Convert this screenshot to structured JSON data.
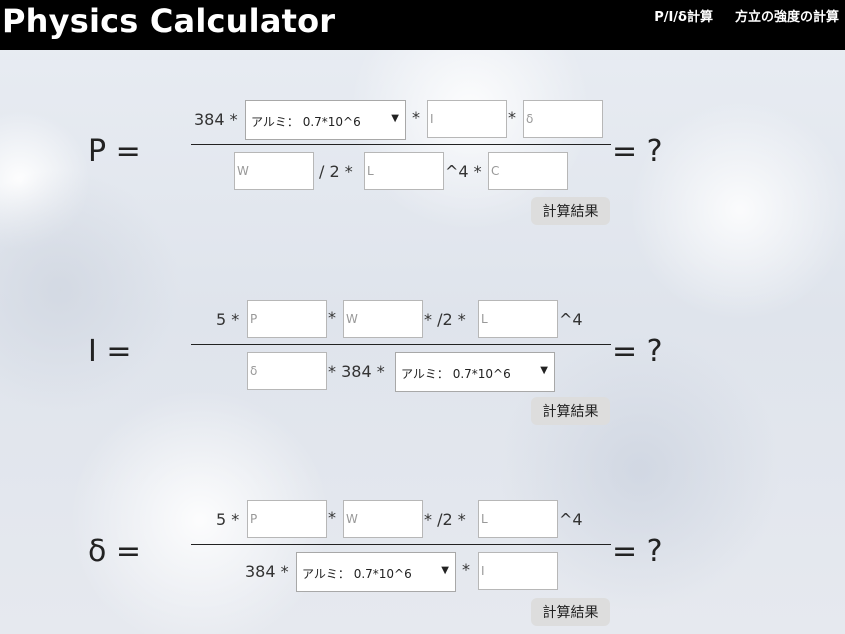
{
  "app": {
    "title": "Physics Calculator",
    "nav": [
      "P/I/δ計算",
      "方立の強度の計算"
    ]
  },
  "sections": {
    "p": {
      "lhs": "P =",
      "rhs": "= ?",
      "num": {
        "t1": "384 *",
        "material": "アルミ： 0.7*10^6",
        "t2": "*",
        "i_ph": "I",
        "t3": "*",
        "d_ph": "δ"
      },
      "den": {
        "w_ph": "W",
        "t1": "/ 2 *",
        "l_ph": "L",
        "t2": "^4 *",
        "c_ph": "C"
      },
      "button": "計算結果"
    },
    "i": {
      "lhs": "I =",
      "rhs": "= ?",
      "num": {
        "t1": "5 *",
        "p_ph": "P",
        "t2": "*",
        "w_ph": "W",
        "t3": "* /2 *",
        "l_ph": "L",
        "t4": "^4"
      },
      "den": {
        "d_ph": "δ",
        "t1": "* 384 *",
        "material": "アルミ： 0.7*10^6"
      },
      "button": "計算結果"
    },
    "d": {
      "lhs": "δ =",
      "rhs": "= ?",
      "num": {
        "t1": "5 *",
        "p_ph": "P",
        "t2": "*",
        "w_ph": "W",
        "t3": "* /2 *",
        "l_ph": "L",
        "t4": "^4"
      },
      "den": {
        "t1": "384 *",
        "material": "アルミ： 0.7*10^6",
        "t2": "*",
        "i_ph": "I"
      },
      "button": "計算結果"
    }
  },
  "icons": {
    "dropdown": "triangle-down"
  }
}
